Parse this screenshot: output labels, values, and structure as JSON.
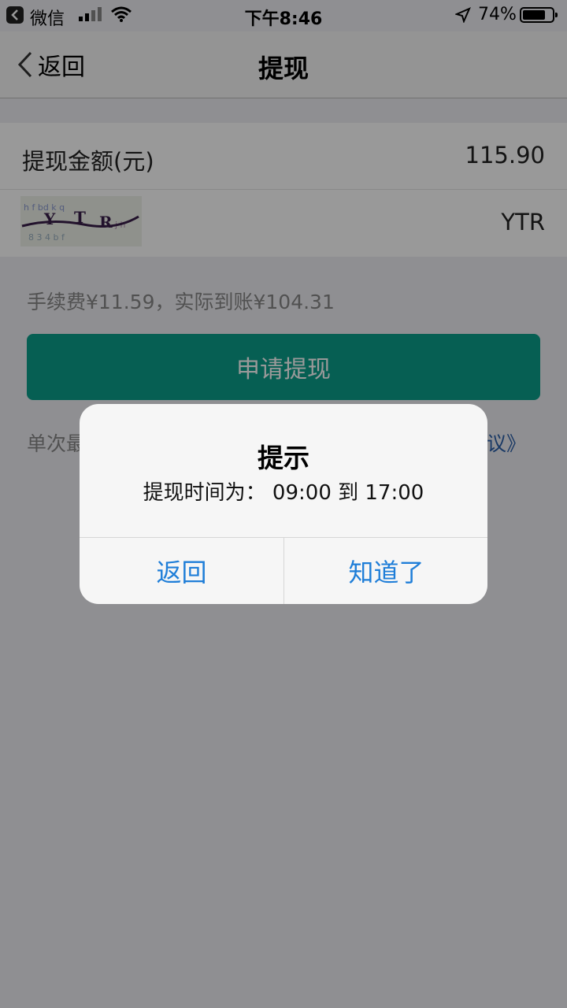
{
  "status_bar": {
    "carrier": "微信",
    "time": "下午8:46",
    "battery": "74%"
  },
  "nav": {
    "back_label": "返回",
    "title": "提现"
  },
  "form": {
    "amount_label": "提现金额(元)",
    "amount_value": "115.90",
    "captcha_value": "YTR"
  },
  "fee_text": "手续费¥11.59，实际到账¥104.31",
  "apply_button": "申请提现",
  "notice": {
    "prefix": "单次最",
    "link_suffix": "议》"
  },
  "alert": {
    "title": "提示",
    "message": "提现时间为： 09:00 到 17:00",
    "left_button": "返回",
    "right_button": "知道了"
  },
  "colors": {
    "accent": "#0a9e8a",
    "link": "#1f7ed8"
  }
}
